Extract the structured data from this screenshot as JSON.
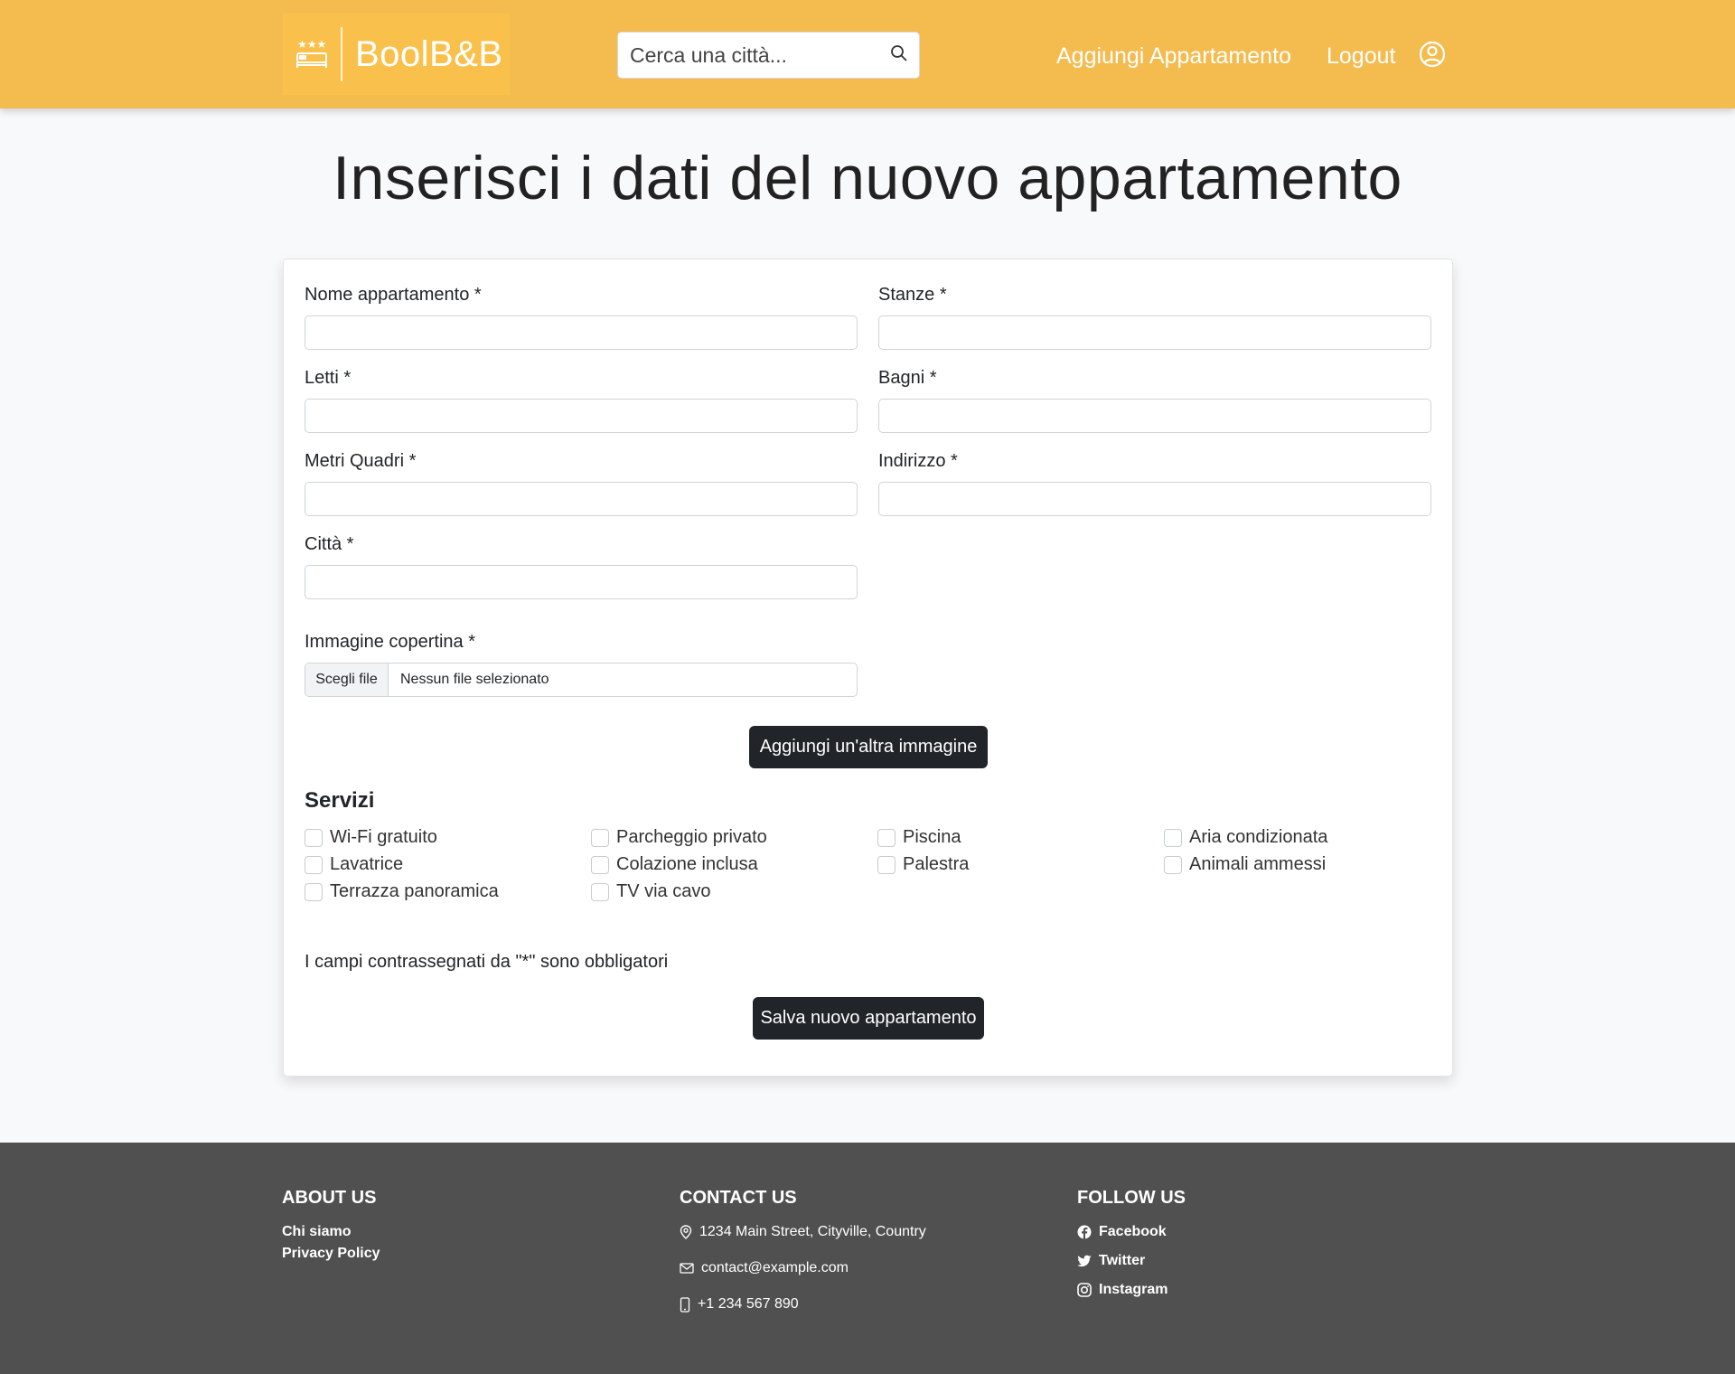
{
  "header": {
    "logo_text": "BoolB&B",
    "search_placeholder": "Cerca una città...",
    "nav_add": "Aggiungi Appartamento",
    "nav_logout": "Logout"
  },
  "page_title": "Inserisci i dati del nuovo appartamento",
  "form": {
    "labels": {
      "name": "Nome appartamento *",
      "rooms": "Stanze *",
      "beds": "Letti *",
      "bathrooms": "Bagni *",
      "square_meters": "Metri Quadri *",
      "address": "Indirizzo *",
      "city": "Città *",
      "cover_image": "Immagine copertina *"
    },
    "file_button": "Scegli file",
    "file_status": "Nessun file selezionato",
    "add_image_button": "Aggiungi un'altra immagine",
    "services_title": "Servizi",
    "services": [
      "Wi-Fi gratuito",
      "Parcheggio privato",
      "Piscina",
      "Aria condizionata",
      "Lavatrice",
      "Colazione inclusa",
      "Palestra",
      "Animali ammessi",
      "Terrazza panoramica",
      "TV via cavo"
    ],
    "required_note": "I campi contrassegnati da \"*\" sono obbligatori",
    "submit_button": "Salva nuovo appartamento"
  },
  "footer": {
    "about": {
      "title": "ABOUT US",
      "links": [
        "Chi siamo",
        "Privacy Policy"
      ]
    },
    "contact": {
      "title": "CONTACT US",
      "address": "1234 Main Street, Cityville, Country",
      "email": "contact@example.com",
      "phone": "+1 234 567 890"
    },
    "follow": {
      "title": "FOLLOW US",
      "links": [
        "Facebook",
        "Twitter",
        "Instagram"
      ]
    }
  },
  "colors": {
    "header_bg": "#f4bc4f",
    "footer_bg": "#505050",
    "button_dark": "#212529"
  },
  "icons": {
    "logo": "bed-stars-icon",
    "search": "search-icon",
    "user": "user-circle-icon",
    "location": "map-pin-icon",
    "email": "envelope-icon",
    "phone": "phone-icon",
    "facebook": "facebook-icon",
    "twitter": "twitter-icon",
    "instagram": "instagram-icon"
  }
}
